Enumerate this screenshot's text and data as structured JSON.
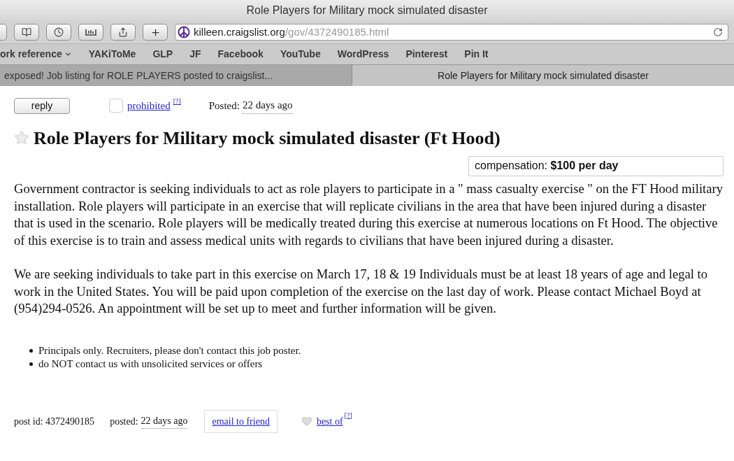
{
  "window": {
    "title": "Role Players for Military mock simulated disaster"
  },
  "toolbar": {
    "url_host": "killeen.craigslist.org",
    "url_path": "/gov/4372490185.html"
  },
  "bookmarks": [
    {
      "label": "ork reference",
      "has_menu": true
    },
    {
      "label": "YAKiToMe",
      "has_menu": false
    },
    {
      "label": "GLP",
      "has_menu": false
    },
    {
      "label": "JF",
      "has_menu": false
    },
    {
      "label": "Facebook",
      "has_menu": false
    },
    {
      "label": "YouTube",
      "has_menu": false
    },
    {
      "label": "WordPress",
      "has_menu": false
    },
    {
      "label": "Pinterest",
      "has_menu": false
    },
    {
      "label": "Pin It",
      "has_menu": false
    }
  ],
  "tabs": [
    {
      "label": "exposed! Job listing for ROLE PLAYERS posted to craigslist...",
      "selected": false
    },
    {
      "label": "Role Players for Military mock simulated disaster",
      "selected": true
    }
  ],
  "post": {
    "reply_button": "reply",
    "flag": {
      "checked": false,
      "label": "prohibited",
      "help": "[?]"
    },
    "posted_label": "Posted:",
    "posted_time": "22 days ago",
    "title": "Role Players for Military mock simulated disaster (Ft Hood)",
    "starred": false,
    "compensation": "compensation: **$100 per day**",
    "paragraphs": [
      "Government contractor is seeking individuals to act as role players to participate in a \" mass casualty exercise \" on the FT Hood military installation. Role players will participate in an exercise that will replicate civilians in the area that have been injured during a disaster that is used in the scenario. Role players will be medically treated during this exercise at numerous locations on Ft Hood. The objective of this exercise is to train and assess medical units with regards to civilians that have been injured during a disaster.",
      "We are seeking individuals to take part in this exercise on March 17, 18 & 19 Individuals must be at least 18 years of age and legal to work in the United States. You will be paid upon completion of the exercise on the last day of work. Please contact Michael Boyd at (954)294-0526. An appointment will be set up to meet and further information will be given."
    ],
    "notices": [
      "Principals only. Recruiters, please don't contact this job poster.",
      "do NOT contact us with unsolicited services or offers"
    ],
    "footer": {
      "post_id": "post id: 4372490185",
      "posted_label": "posted:",
      "posted_time": "22 days ago",
      "email_link": "email to friend",
      "best_of": {
        "favorited": false,
        "label": "best of",
        "help": "[?]"
      }
    }
  }
}
